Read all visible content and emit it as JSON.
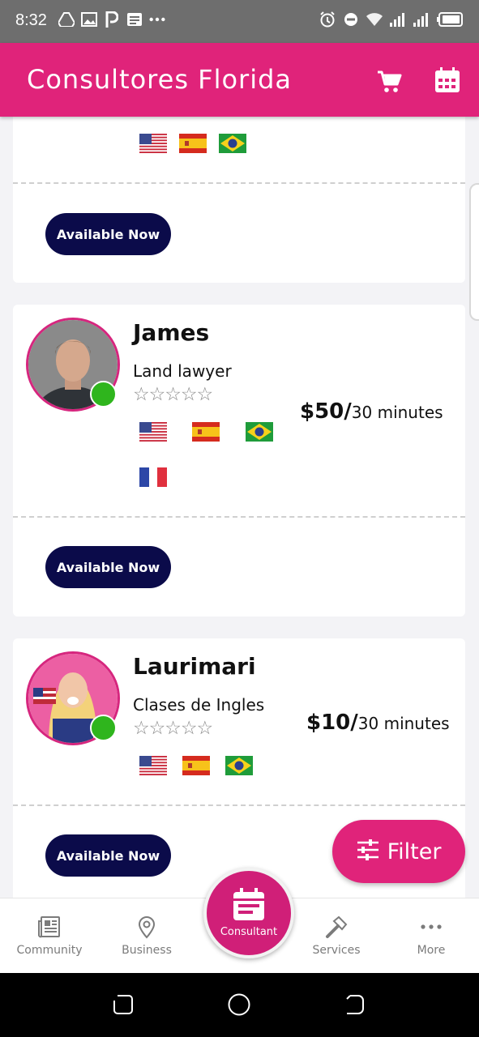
{
  "status_bar": {
    "time": "8:32",
    "left_icons": [
      "drive-icon",
      "image-icon",
      "parking-icon",
      "news-icon",
      "more-dots-icon"
    ],
    "right_icons": [
      "alarm-icon",
      "dnd-icon",
      "wifi-icon",
      "signal-icon",
      "signal-icon",
      "battery-icon"
    ]
  },
  "app_bar": {
    "title": "Consultores Florida",
    "icons": [
      "cart-icon",
      "calendar-icon"
    ],
    "color": "#e0237a"
  },
  "consultants": [
    {
      "name": "",
      "flags": [
        "us",
        "es",
        "br"
      ],
      "button_label": "Available Now"
    },
    {
      "name": "James",
      "role": "Land lawyer",
      "rating": 0,
      "stars": "☆☆☆☆☆",
      "price": "$50/",
      "price_unit": "30 minutes",
      "flags": [
        "us",
        "es",
        "br",
        "fr"
      ],
      "button_label": "Available Now",
      "online": true
    },
    {
      "name": "Laurimari",
      "role": "Clases de Ingles",
      "rating": 0,
      "stars": "☆☆☆☆☆",
      "price": "$10/",
      "price_unit": "30 minutes",
      "flags": [
        "us",
        "es",
        "br"
      ],
      "button_label": "Available Now",
      "online": true
    }
  ],
  "filter_button": {
    "label": "Filter",
    "icon": "sliders-icon"
  },
  "bottom_nav": {
    "items": [
      {
        "label": "Community",
        "icon": "newspaper-icon"
      },
      {
        "label": "Business",
        "icon": "map-pin-icon"
      },
      {
        "label": "Consultant",
        "icon": "calendar-icon"
      },
      {
        "label": "Services",
        "icon": "hammer-icon"
      },
      {
        "label": "More",
        "icon": "more-dots-icon"
      }
    ]
  },
  "colors": {
    "primary": "#e0237a",
    "button_dark": "#0b0b4a",
    "online": "#2fb51d"
  }
}
